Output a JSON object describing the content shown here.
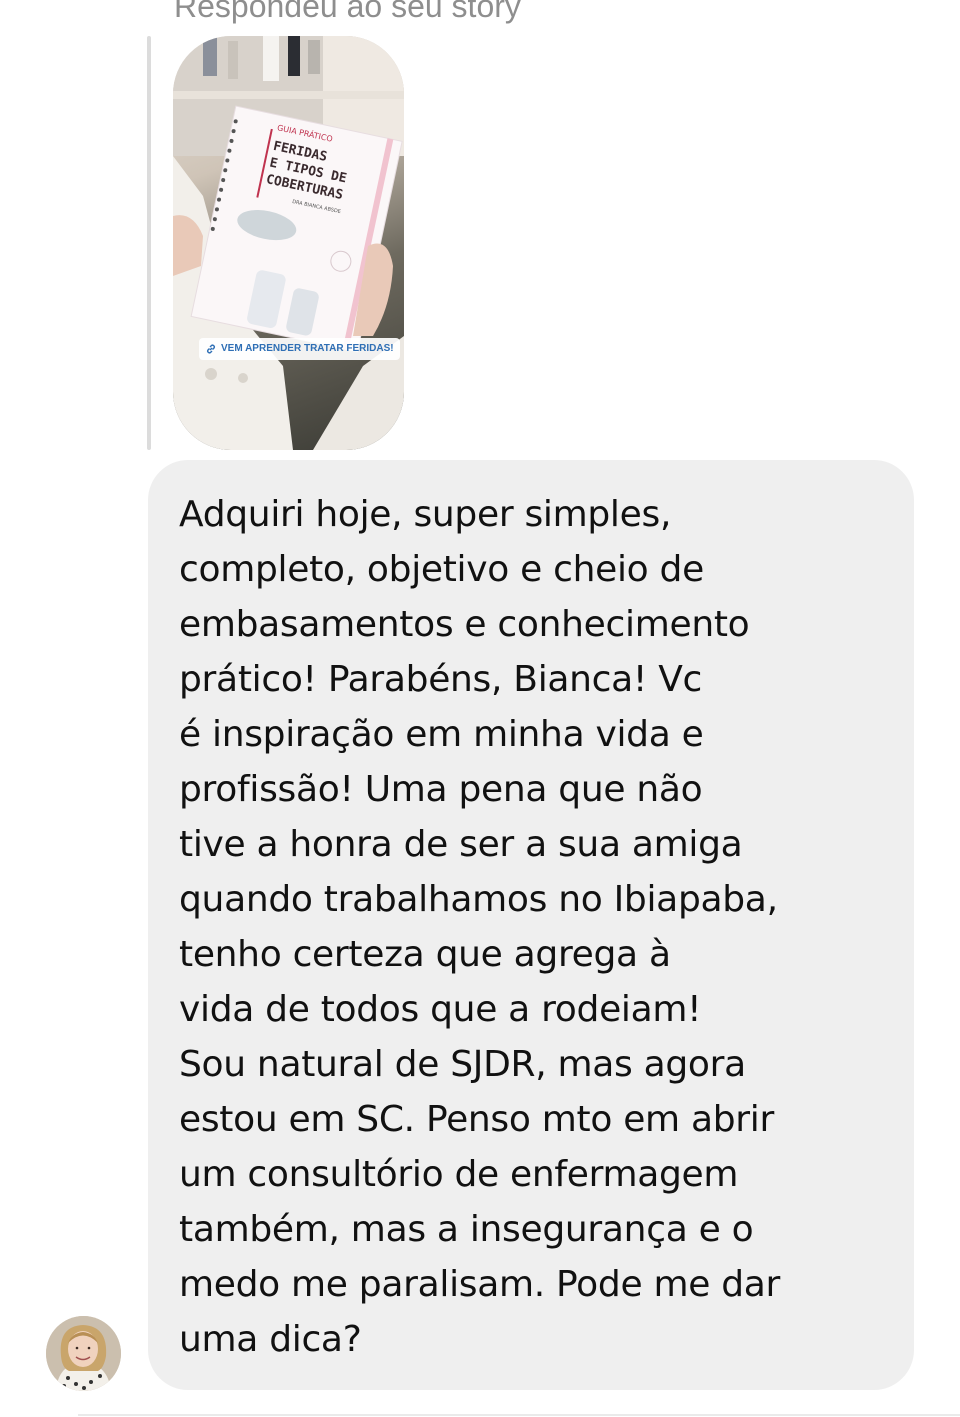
{
  "reply": {
    "label": "Respondeu ao seu story"
  },
  "story": {
    "book_cover": {
      "subtitle": "GUIA PRÁTICO",
      "title_line1": "FERIDAS",
      "title_line2": "E TIPOS DE",
      "title_line3": "COBERTURAS",
      "author": "DRA BIANCA ABSDE"
    },
    "link_sticker_label": "VEM APRENDER TRATAR FERIDAS!",
    "link_icon": "link-icon"
  },
  "message": {
    "text": "Adquiri hoje, super simples,\ncompleto, objetivo e cheio de\nembasamentos e conhecimento\nprático! Parabéns, Bianca! Vc\né inspiração em minha vida e\nprofissão! Uma pena que não\ntive a honra de ser a sua amiga\nquando trabalhamos no Ibiapaba,\ntenho certeza que agrega à\nvida de todos que a rodeiam!\nSou natural de SJDR, mas agora\nestou em SC. Penso mto em abrir\num consultório de enfermagem\ntambém, mas a insegurança e o\nmedo me paralisam. Pode me dar\numa dica?"
  },
  "sender": {
    "avatar_icon": "user-avatar"
  },
  "colors": {
    "bubble_background": "#efefef",
    "secondary_text": "#8e8e8e",
    "link_text": "#2f6fb5"
  }
}
